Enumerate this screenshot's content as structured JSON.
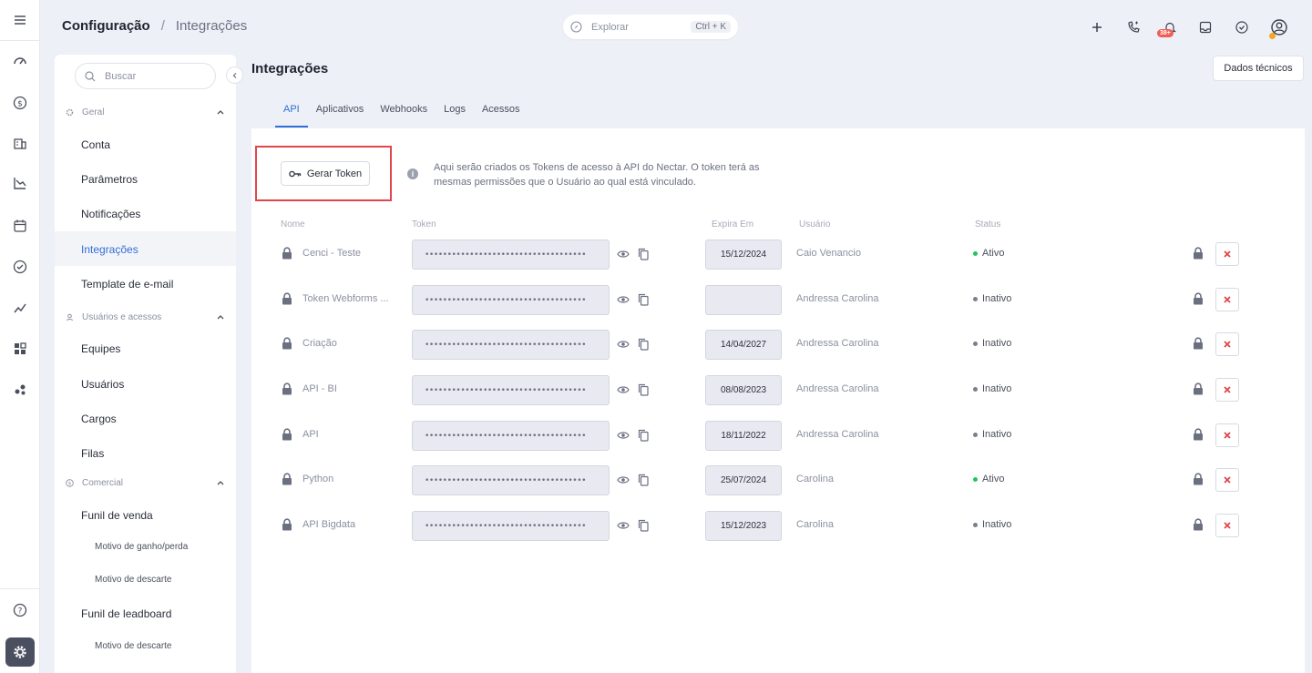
{
  "breadcrumb": {
    "root": "Configuração",
    "separator": "/",
    "current": "Integrações"
  },
  "top_search": {
    "placeholder": "Explorar",
    "shortcut": "Ctrl + K"
  },
  "notification_badge": "38+",
  "sidebar": {
    "search_placeholder": "Buscar",
    "sections": [
      {
        "label": "Geral",
        "items": [
          "Conta",
          "Parâmetros",
          "Notificações",
          "Integrações",
          "Template de e-mail"
        ]
      },
      {
        "label": "Usuários e acessos",
        "items": [
          "Equipes",
          "Usuários",
          "Cargos",
          "Filas"
        ]
      },
      {
        "label": "Comercial",
        "items": [
          "Funil de venda",
          "Motivo de ganho/perda",
          "Motivo de descarte",
          "Funil de leadboard",
          "Motivo de descarte"
        ]
      }
    ],
    "active_item": "Integrações"
  },
  "main": {
    "title": "Integrações",
    "tech_button": "Dados técnicos",
    "tabs": [
      "API",
      "Aplicativos",
      "Webhooks",
      "Logs",
      "Acessos"
    ],
    "active_tab": "API",
    "generate_button": "Gerar Token",
    "info_text": "Aqui serão criados os Tokens de acesso à API do Nectar. O token terá as mesmas permissões que o Usuário ao qual está vinculado.",
    "columns": {
      "name": "Nome",
      "token": "Token",
      "expires": "Expira Em",
      "user": "Usuário",
      "status": "Status"
    },
    "token_mask": "••••••••••••••••••••••••••••••••••••",
    "rows": [
      {
        "name": "Cenci - Teste",
        "expires": "15/12/2024",
        "user": "Caio Venancio",
        "status": "Ativo"
      },
      {
        "name": "Token Webforms ...",
        "expires": "",
        "user": "Andressa Carolina",
        "status": "Inativo"
      },
      {
        "name": "Criação",
        "expires": "14/04/2027",
        "user": "Andressa Carolina",
        "status": "Inativo"
      },
      {
        "name": "API - BI",
        "expires": "08/08/2023",
        "user": "Andressa Carolina",
        "status": "Inativo"
      },
      {
        "name": "API",
        "expires": "18/11/2022",
        "user": "Andressa Carolina",
        "status": "Inativo"
      },
      {
        "name": "Python",
        "expires": "25/07/2024",
        "user": "Carolina",
        "status": "Ativo"
      },
      {
        "name": "API Bigdata",
        "expires": "15/12/2023",
        "user": "Carolina",
        "status": "Inativo"
      }
    ]
  },
  "colors": {
    "accent": "#2f6fd6",
    "active": "#22c55e",
    "inactive": "#7a7f8c",
    "danger": "#e0464a"
  }
}
